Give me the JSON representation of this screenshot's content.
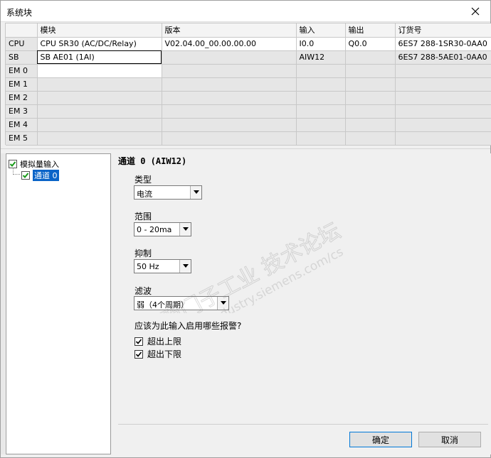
{
  "window": {
    "title": "系统块"
  },
  "table": {
    "headers": [
      "",
      "模块",
      "版本",
      "输入",
      "输出",
      "订货号"
    ],
    "rows": [
      {
        "slot": "CPU",
        "module": "CPU SR30 (AC/DC/Relay)",
        "version": "V02.04.00_00.00.00.00",
        "input": "I0.0",
        "output": "Q0.0",
        "order": "6ES7 288-1SR30-0AA0"
      },
      {
        "slot": "SB",
        "module": "SB AE01 (1AI)",
        "version": "",
        "input": "AIW12",
        "output": "",
        "order": "6ES7 288-5AE01-0AA0"
      },
      {
        "slot": "EM 0",
        "module": "",
        "version": "",
        "input": "",
        "output": "",
        "order": ""
      },
      {
        "slot": "EM 1",
        "module": "",
        "version": "",
        "input": "",
        "output": "",
        "order": ""
      },
      {
        "slot": "EM 2",
        "module": "",
        "version": "",
        "input": "",
        "output": "",
        "order": ""
      },
      {
        "slot": "EM 3",
        "module": "",
        "version": "",
        "input": "",
        "output": "",
        "order": ""
      },
      {
        "slot": "EM 4",
        "module": "",
        "version": "",
        "input": "",
        "output": "",
        "order": ""
      },
      {
        "slot": "EM 5",
        "module": "",
        "version": "",
        "input": "",
        "output": "",
        "order": ""
      }
    ]
  },
  "tree": {
    "root": {
      "label": "模拟量输入",
      "checked": true
    },
    "child": {
      "label": "通道 0",
      "checked": true,
      "selected": true
    }
  },
  "panel": {
    "heading": "通道 0 (AIW12)",
    "type_label": "类型",
    "type_value": "电流",
    "range_label": "范围",
    "range_value": "0 - 20ma",
    "suppress_label": "抑制",
    "suppress_value": "50 Hz",
    "filter_label": "滤波",
    "filter_value": "弱（4个周期）",
    "alarm_question": "应该为此输入启用哪些报警?",
    "alarm_upper": "超出上限",
    "alarm_lower": "超出下限"
  },
  "buttons": {
    "ok": "确定",
    "cancel": "取消"
  },
  "watermark": {
    "line1": "西门子工业 技术论坛",
    "line2": "support.industry.siemens.com/cs"
  }
}
